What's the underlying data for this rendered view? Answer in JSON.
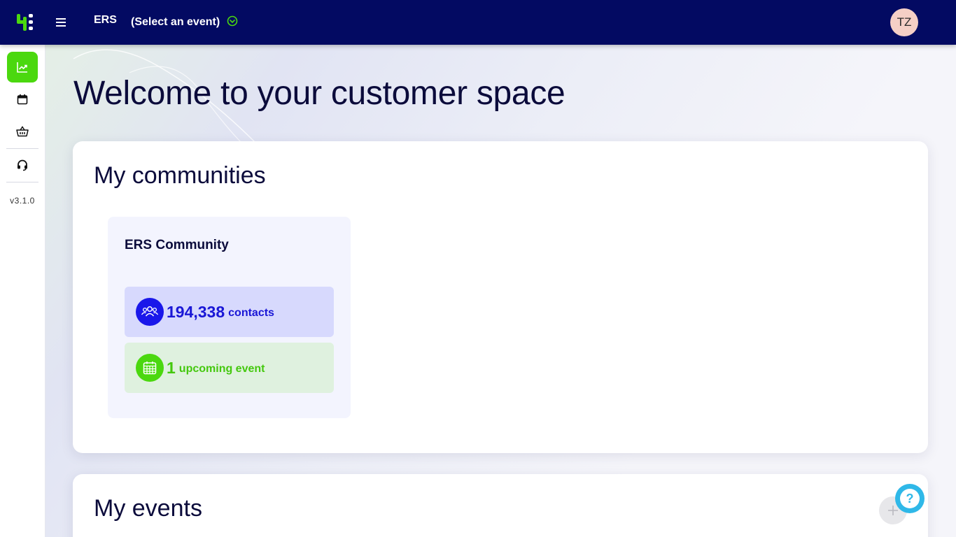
{
  "header": {
    "brand": "ERS",
    "event_select_label": "(Select an event)",
    "user_initials": "TZ"
  },
  "sidebar": {
    "items": [
      {
        "name": "dashboard",
        "icon": "chart-trend-icon",
        "active": true
      },
      {
        "name": "calendar",
        "icon": "calendar-icon",
        "active": false
      },
      {
        "name": "shop",
        "icon": "basket-icon",
        "active": false
      },
      {
        "name": "support",
        "icon": "headset-icon",
        "active": false
      }
    ],
    "version": "v3.1.0"
  },
  "main": {
    "welcome_prefix": "Welcome to your",
    "welcome_strong": "customer space",
    "communities": {
      "title": "My communities",
      "cards": [
        {
          "name": "ERS Community",
          "contacts_value": "194,338",
          "contacts_label": "contacts",
          "events_value": "1",
          "events_label": "upcoming event"
        }
      ]
    },
    "events": {
      "title": "My events"
    }
  },
  "colors": {
    "topbar": "#030a62",
    "accent_green": "#4bd80f",
    "accent_blue": "#1a17ea",
    "help": "#2fb8e8",
    "avatar_bg": "#f5cfc6"
  }
}
